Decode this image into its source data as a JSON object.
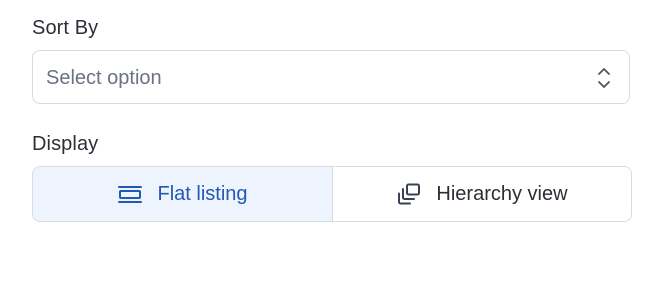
{
  "sort": {
    "label": "Sort By",
    "placeholder": "Select option",
    "icon": "chevron-up-down-icon"
  },
  "display": {
    "label": "Display",
    "options": [
      {
        "label": "Flat listing",
        "icon": "flat-list-icon",
        "selected": true
      },
      {
        "label": "Hierarchy view",
        "icon": "stacked-layers-icon",
        "selected": false
      }
    ]
  },
  "colors": {
    "selected_bg": "#eef4fd",
    "selected_text": "#2357b7",
    "border": "#d7dbe1",
    "placeholder_text": "#6b7280"
  }
}
